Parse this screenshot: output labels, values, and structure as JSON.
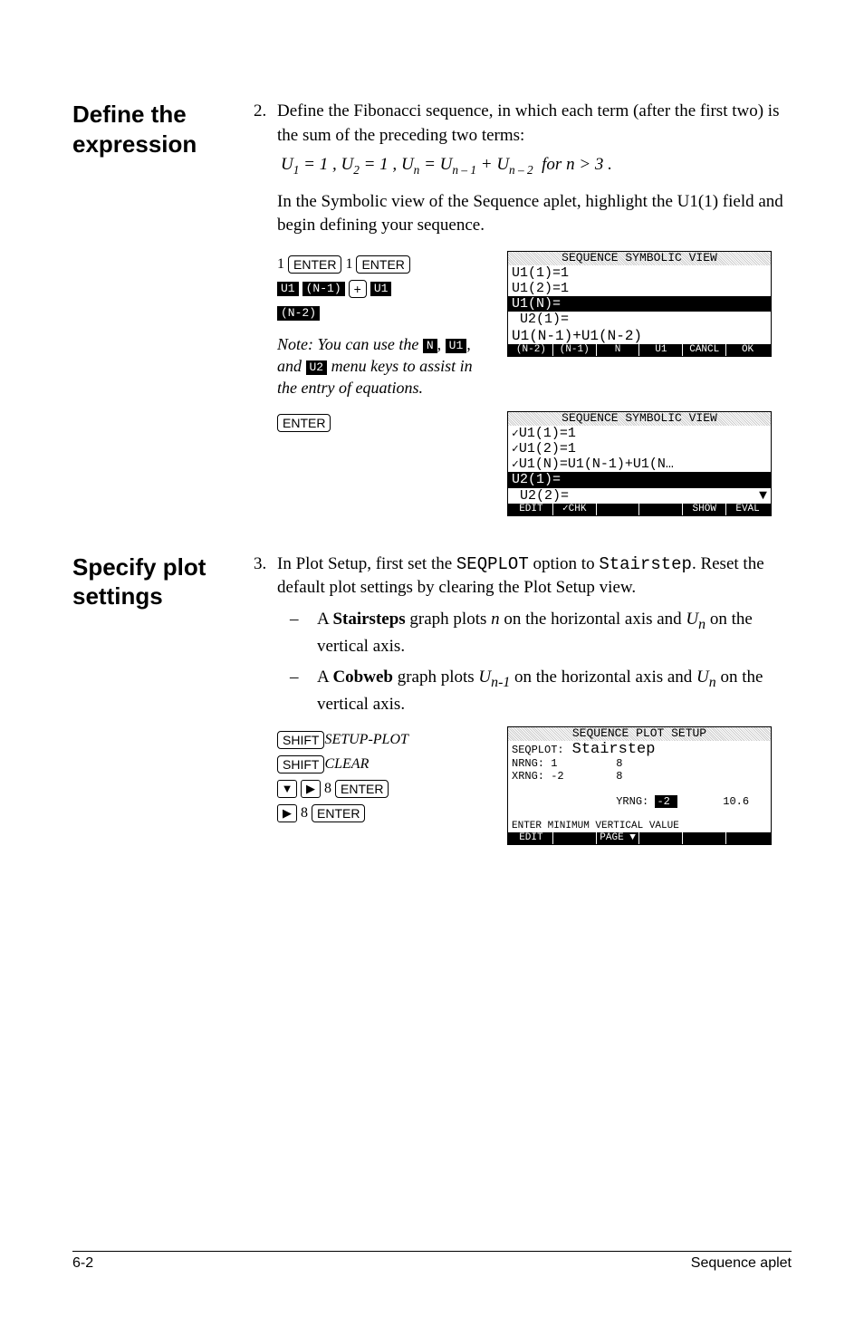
{
  "section1": {
    "heading": "Define the expression",
    "step_num": "2.",
    "step_text": "Define the Fibonacci sequence, in which each term (after the first two) is the sum of the preceding two terms:",
    "formula_plain": "U₁ = 1 , U₂ = 1 , Uₙ = Uₙ₋₁ + Uₙ₋₂  for n > 3 .",
    "para1": "In the Symbolic view of the Sequence aplet, highlight the U1(1) field and begin defining your sequence.",
    "keys_row1_a": "1",
    "keys_row1_enter": "ENTER",
    "keys_row1_b": "1",
    "soft_u1": "U1",
    "soft_nminus1": "(N-1)",
    "plus_key": "+",
    "soft_nminus2": "(N-2)",
    "note_prefix": "Note: You can use the",
    "note_n": "N",
    "note_u1": "U1",
    "note_and": ", and",
    "note_u2": "U2",
    "note_suffix": "menu keys to assist in the entry of equations.",
    "enter_key": "ENTER",
    "screen1": {
      "title": "SEQUENCE SYMBOLIC VIEW",
      "l1": "U1(1)=1",
      "l2": "U1(2)=1",
      "l3": "U1(N)=",
      "l4": " U2(1)=",
      "editline": "U1(N-1)+U1(N-2)",
      "sk": [
        "(N-2)",
        "(N-1)",
        "N",
        "U1",
        "CANCL",
        "OK"
      ]
    },
    "screen2": {
      "title": "SEQUENCE SYMBOLIC VIEW",
      "l1": "U1(1)=1",
      "l2": "U1(2)=1",
      "l3": "U1(N)=U1(N-1)+U1(N…",
      "l4": "U2(1)=",
      "l5": " U2(2)=",
      "sk": [
        "EDIT",
        "✓CHK",
        "",
        "",
        "SHOW",
        "EVAL"
      ]
    }
  },
  "section2": {
    "heading": "Specify plot settings",
    "step_num": "3.",
    "step_text_a": "In Plot Setup, first set the ",
    "seqplot_word": "SEQPLOT",
    "step_text_b": " option to ",
    "stairstep_word": "Stairstep",
    "step_text_c": ". Reset the default plot settings by clearing the Plot Setup view.",
    "bullet1_a": "A ",
    "bullet1_bold": "Stairsteps",
    "bullet1_b": " graph plots ",
    "bullet1_n": "n",
    "bullet1_c": " on the horizontal axis and ",
    "bullet1_un": "Uₙ",
    "bullet1_d": " on the vertical axis.",
    "bullet2_a": "A ",
    "bullet2_bold": "Cobweb",
    "bullet2_b": " graph plots ",
    "bullet2_un1": "Uₙ₋₁",
    "bullet2_c": " on the horizontal axis and ",
    "bullet2_un": "Uₙ",
    "bullet2_d": " on the vertical axis.",
    "shift_key": "SHIFT",
    "setup_plot": "SETUP-PLOT",
    "clear": "CLEAR",
    "eight": "8",
    "enter": "ENTER",
    "screen3": {
      "title": "SEQUENCE PLOT SETUP",
      "l1_label": "SEQPLOT:",
      "l1_val": "Stairstep",
      "l2": "NRNG: 1         8",
      "l3": "XRNG: -2        8",
      "l4a": "YRNG: ",
      "l4hl": "-2",
      "l4b": "       10.6",
      "msg": "ENTER MINIMUM VERTICAL VALUE",
      "sk": [
        "EDIT",
        "",
        "PAGE ▼",
        "",
        "",
        ""
      ]
    }
  },
  "footer": {
    "left": "6-2",
    "right": "Sequence aplet"
  }
}
